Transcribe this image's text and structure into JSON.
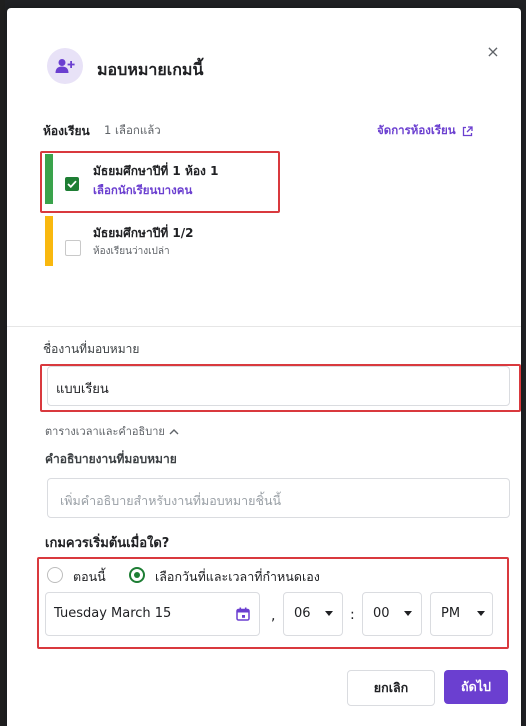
{
  "dialog": {
    "title": "มอบหมายเกมนี้",
    "close_label": "×"
  },
  "classes_section": {
    "label": "ห้องเรียน",
    "selected_count": "1 เลือกแล้ว",
    "manage_link": "จัดการห้องเรียน",
    "items": [
      {
        "name": "มัธยมศึกษาปีที่ 1 ห้อง 1",
        "sub": "เลือกนักเรียนบางคน",
        "checked": true,
        "color": "#3aa34b"
      },
      {
        "name": "มัธยมศึกษาปีที่ 1/2",
        "sub": "ห้องเรียนว่างเปล่า",
        "checked": false,
        "color": "#f9b80f"
      }
    ]
  },
  "assignment": {
    "name_label": "ชื่องานที่มอบหมาย",
    "name_value": "แบบเรียน",
    "schedule_toggle": "ตารางเวลาและคำอธิบาย",
    "description_label": "คำอธิบายงานที่มอบหมาย",
    "description_placeholder": "เพิ่มคำอธิบายสำหรับงานที่มอบหมายชิ้นนี้"
  },
  "start": {
    "question": "เกมควรเริ่มต้นเมื่อใด?",
    "options": [
      "ตอนนี้",
      "เลือกวันที่และเวลาที่กำหนดเอง"
    ],
    "selected_option": "เลือกวันที่และเวลาที่กำหนดเอง",
    "date": "Tuesday March 15",
    "comma": ",",
    "hour": "06",
    "colon": ":",
    "minute": "00",
    "ampm": "PM"
  },
  "footer": {
    "cancel_label": "ยกเลิก",
    "next_label": "ถัดไป"
  },
  "colors": {
    "accent": "#6b3fd0",
    "check_green": "#1e7e34",
    "highlight_red": "#d9393e"
  }
}
